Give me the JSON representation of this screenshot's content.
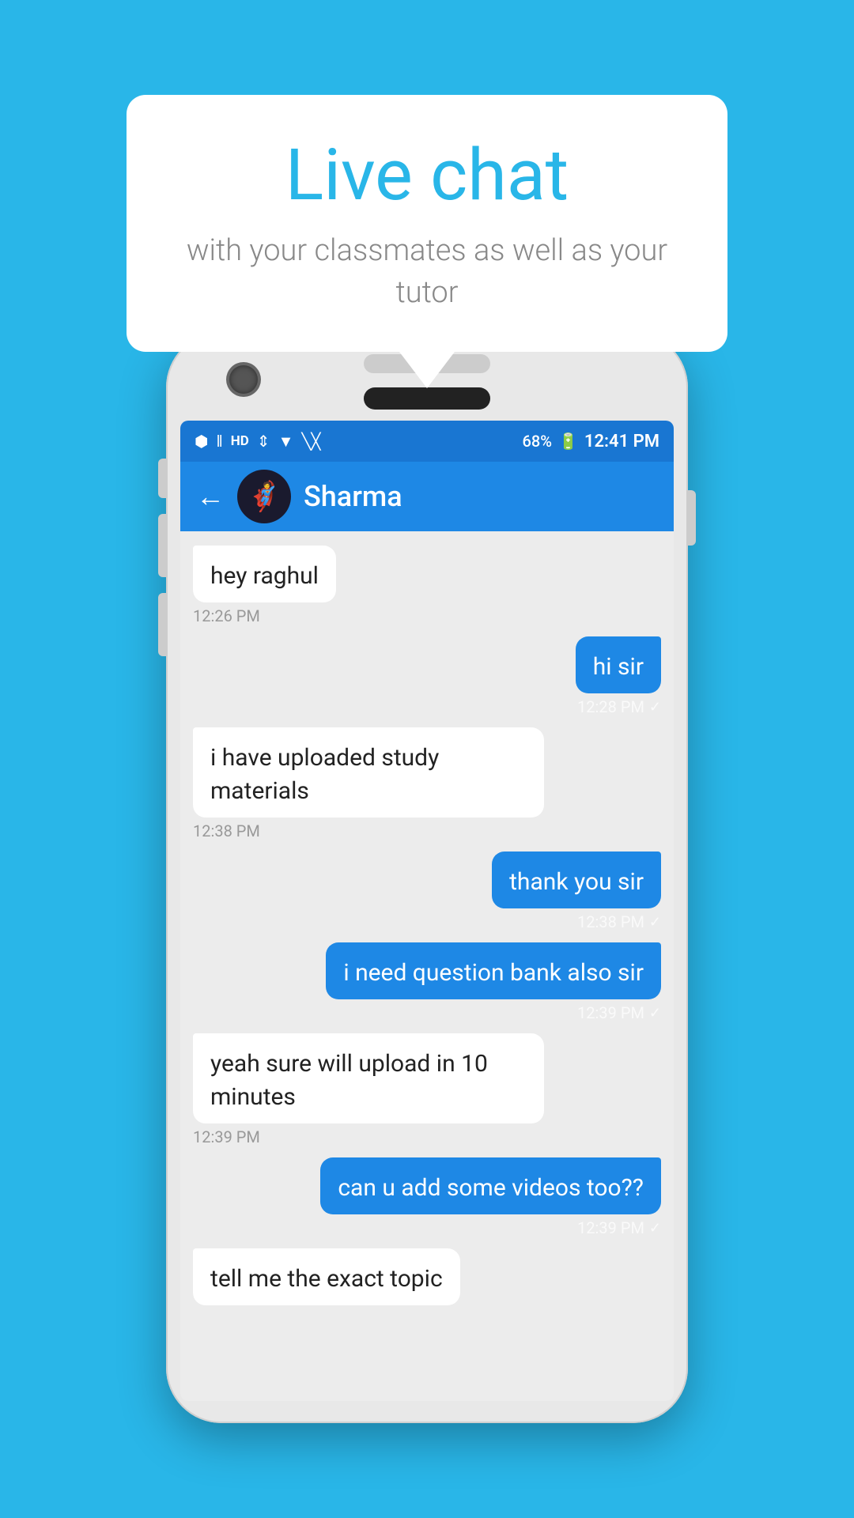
{
  "background_color": "#29b6e8",
  "speech_bubble": {
    "title": "Live chat",
    "subtitle": "with your classmates as well as your tutor"
  },
  "phone": {
    "status_bar": {
      "time": "12:41 PM",
      "battery": "68%",
      "icons": "bluetooth vibrate hd wifi signal"
    },
    "chat_header": {
      "contact_name": "Sharma",
      "back_label": "←"
    },
    "messages": [
      {
        "id": "msg1",
        "type": "received",
        "text": "hey raghul",
        "time": "12:26 PM",
        "check": false
      },
      {
        "id": "msg2",
        "type": "sent",
        "text": "hi sir",
        "time": "12:28 PM",
        "check": true
      },
      {
        "id": "msg3",
        "type": "received",
        "text": "i have uploaded study materials",
        "time": "12:38 PM",
        "check": false
      },
      {
        "id": "msg4",
        "type": "sent",
        "text": "thank you sir",
        "time": "12:38 PM",
        "check": true
      },
      {
        "id": "msg5",
        "type": "sent",
        "text": "i need question bank also sir",
        "time": "12:39 PM",
        "check": true
      },
      {
        "id": "msg6",
        "type": "received",
        "text": "yeah sure will upload in 10 minutes",
        "time": "12:39 PM",
        "check": false
      },
      {
        "id": "msg7",
        "type": "sent",
        "text": "can u add some videos too??",
        "time": "12:39 PM",
        "check": true
      },
      {
        "id": "msg8",
        "type": "received",
        "text": "tell me the exact topic",
        "time": "",
        "check": false,
        "partial": true
      }
    ]
  }
}
